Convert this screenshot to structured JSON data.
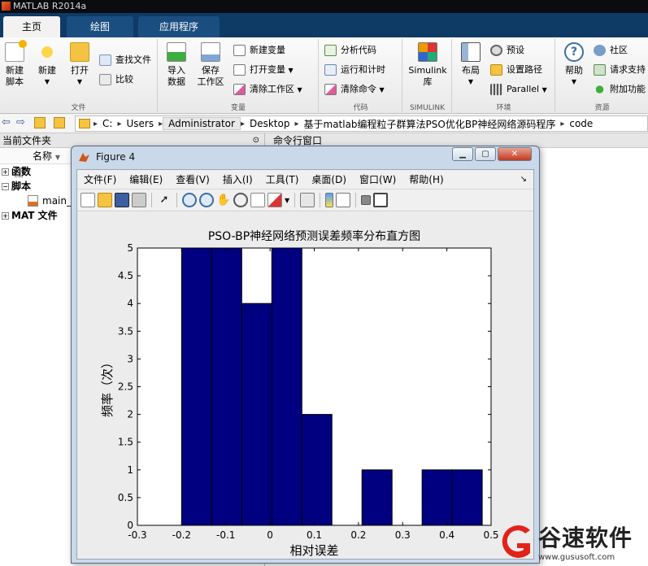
{
  "app": {
    "title": "MATLAB R2014a"
  },
  "ribbon": {
    "tabs": [
      "主页",
      "绘图",
      "应用程序"
    ],
    "sections": {
      "file": {
        "label": "文件",
        "new_script": "新建\n脚本",
        "new": "新建",
        "open": "打开",
        "find_files": "查找文件",
        "compare": "比较"
      },
      "variable": {
        "label": "变量",
        "import": "导入\n数据",
        "save_ws": "保存\n工作区",
        "new_var": "新建变量",
        "open_var": "打开变量",
        "clear_ws": "清除工作区"
      },
      "code": {
        "label": "代码",
        "analyze": "分析代码",
        "run_time": "运行和计时",
        "clear_cmds": "清除命令"
      },
      "simulink": {
        "label": "SIMULINK",
        "simulink": "Simulink\n库"
      },
      "env": {
        "label": "环境",
        "layout": "布局",
        "prefs": "预设",
        "set_path": "设置路径",
        "parallel": "Parallel"
      },
      "resources": {
        "label": "资源",
        "help": "帮助",
        "community": "社区",
        "request_support": "请求支持",
        "addons": "附加功能"
      }
    }
  },
  "address": {
    "crumbs": [
      "C:",
      "Users",
      "Administrator",
      "Desktop",
      "基于matlab编程粒子群算法PSO优化BP神经网络源码程序",
      "code"
    ]
  },
  "left_panel": {
    "header": "当前文件夹",
    "column": "名称",
    "items": [
      {
        "label": "函数",
        "expander": "+"
      },
      {
        "label": "脚本",
        "expander": "−"
      },
      {
        "label": "main_"
      },
      {
        "label": "MAT 文件",
        "expander": "+"
      }
    ]
  },
  "command_window": {
    "header": "命令行窗口"
  },
  "figure": {
    "title": "Figure 4",
    "menu": [
      "文件(F)",
      "编辑(E)",
      "查看(V)",
      "插入(I)",
      "工具(T)",
      "桌面(D)",
      "窗口(W)",
      "帮助(H)"
    ]
  },
  "chart_data": {
    "type": "bar",
    "title": "PSO-BP神经网络预测误差频率分布直方图",
    "xlabel": "相对误差",
    "ylabel": "频率（次）",
    "xlim": [
      -0.3,
      0.5
    ],
    "ylim": [
      0,
      5
    ],
    "xticks": [
      -0.3,
      -0.2,
      -0.1,
      0,
      0.1,
      0.2,
      0.3,
      0.4,
      0.5
    ],
    "yticks": [
      0,
      0.5,
      1,
      1.5,
      2,
      2.5,
      3,
      3.5,
      4,
      4.5,
      5
    ],
    "bar_color": "#000080",
    "bins": [
      {
        "left": -0.2,
        "right": -0.132,
        "count": 5
      },
      {
        "left": -0.132,
        "right": -0.064,
        "count": 5
      },
      {
        "left": -0.064,
        "right": 0.004,
        "count": 4
      },
      {
        "left": 0.004,
        "right": 0.072,
        "count": 5
      },
      {
        "left": 0.072,
        "right": 0.14,
        "count": 2
      },
      {
        "left": 0.14,
        "right": 0.208,
        "count": 0
      },
      {
        "left": 0.208,
        "right": 0.276,
        "count": 1
      },
      {
        "left": 0.276,
        "right": 0.344,
        "count": 0
      },
      {
        "left": 0.344,
        "right": 0.412,
        "count": 1
      },
      {
        "left": 0.412,
        "right": 0.48,
        "count": 1
      }
    ]
  },
  "watermark": {
    "name": "谷速软件",
    "url": "www.gususoft.com"
  }
}
